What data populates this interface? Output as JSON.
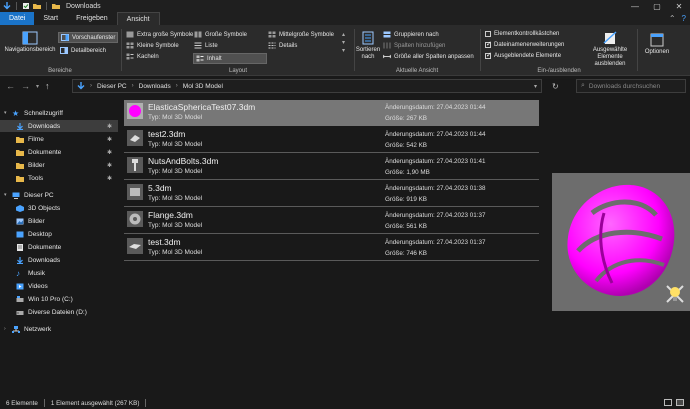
{
  "window": {
    "title": "Downloads",
    "controls": {
      "minimize": "—",
      "maximize": "▢",
      "close": "✕"
    }
  },
  "tabs": [
    {
      "label": "Datei"
    },
    {
      "label": "Start"
    },
    {
      "label": "Freigeben"
    },
    {
      "label": "Ansicht"
    }
  ],
  "ribbon": {
    "bereiche": {
      "navigationsbereich": "Navigationsbereich",
      "vorschaufenster": "Vorschaufenster",
      "detailbereich": "Detailbereich",
      "label": "Bereiche"
    },
    "layout": {
      "extra_grosse_symbole": "Extra große Symbole",
      "grosse_symbole": "Große Symbole",
      "mittelgrosse_symbole": "Mittelgroße Symbole",
      "kleine_symbole": "Kleine Symbole",
      "liste": "Liste",
      "details": "Details",
      "kacheln": "Kacheln",
      "inhalt": "Inhalt",
      "label": "Layout"
    },
    "aktuelle_ansicht": {
      "sortieren": "Sortieren",
      "sortieren_nach": "nach",
      "gruppieren_nach": "Gruppieren nach",
      "spalten_hinzufuegen": "Spalten hinzufügen",
      "groesse_aller_spalten": "Größe aller Spalten anpassen",
      "label": "Aktuelle Ansicht"
    },
    "ein_ausblenden": {
      "elementkontrollkaestchen": "Elementkontrollkästchen",
      "dateinamenerweiterungen": "Dateinamenerweiterungen",
      "ausgeblendete_elemente": "Ausgeblendete Elemente",
      "ausgewaehlte_ausblenden_1": "Ausgewählte",
      "ausgewaehlte_ausblenden_2": "Elemente ausblenden",
      "label": "Ein-/ausblenden"
    },
    "optionen": "Optionen"
  },
  "address": {
    "crumbs": [
      "Dieser PC",
      "Downloads",
      "Mol 3D Model"
    ],
    "search_placeholder": "Downloads durchsuchen"
  },
  "sidebar": {
    "items": [
      {
        "label": "Schnellzugriff"
      },
      {
        "label": "Downloads"
      },
      {
        "label": "Filme"
      },
      {
        "label": "Dokumente"
      },
      {
        "label": "Bilder"
      },
      {
        "label": "Tools"
      },
      {
        "label": "Dieser PC"
      },
      {
        "label": "3D Objects"
      },
      {
        "label": "Bilder"
      },
      {
        "label": "Desktop"
      },
      {
        "label": "Dokumente"
      },
      {
        "label": "Downloads"
      },
      {
        "label": "Musik"
      },
      {
        "label": "Videos"
      },
      {
        "label": "Win 10 Pro (C:)"
      },
      {
        "label": "Diverse Dateien (D:)"
      },
      {
        "label": "Netzwerk"
      }
    ]
  },
  "files": [
    {
      "name": "ElasticaSphericaTest07.3dm",
      "type": "Typ: Mol 3D Model",
      "date": "Änderungsdatum: 27.04.2023 01:44",
      "size": "Größe: 267 KB"
    },
    {
      "name": "test2.3dm",
      "type": "Typ: Mol 3D Model",
      "date": "Änderungsdatum: 27.04.2023 01:44",
      "size": "Größe: 542 KB"
    },
    {
      "name": "NutsAndBolts.3dm",
      "type": "Typ: Mol 3D Model",
      "date": "Änderungsdatum: 27.04.2023 01:41",
      "size": "Größe: 1,90 MB"
    },
    {
      "name": "5.3dm",
      "type": "Typ: Mol 3D Model",
      "date": "Änderungsdatum: 27.04.2023 01:38",
      "size": "Größe: 919 KB"
    },
    {
      "name": "Flange.3dm",
      "type": "Typ: Mol 3D Model",
      "date": "Änderungsdatum: 27.04.2023 01:37",
      "size": "Größe: 561 KB"
    },
    {
      "name": "test.3dm",
      "type": "Typ: Mol 3D Model",
      "date": "Änderungsdatum: 27.04.2023 01:37",
      "size": "Größe: 746 KB"
    }
  ],
  "status": {
    "count": "6 Elemente",
    "selected": "1 Element ausgewählt (267 KB)"
  },
  "colors": {
    "accent": "#1a73c8",
    "preview_shape": "#ff00ff",
    "folder": "#e8b84a"
  }
}
